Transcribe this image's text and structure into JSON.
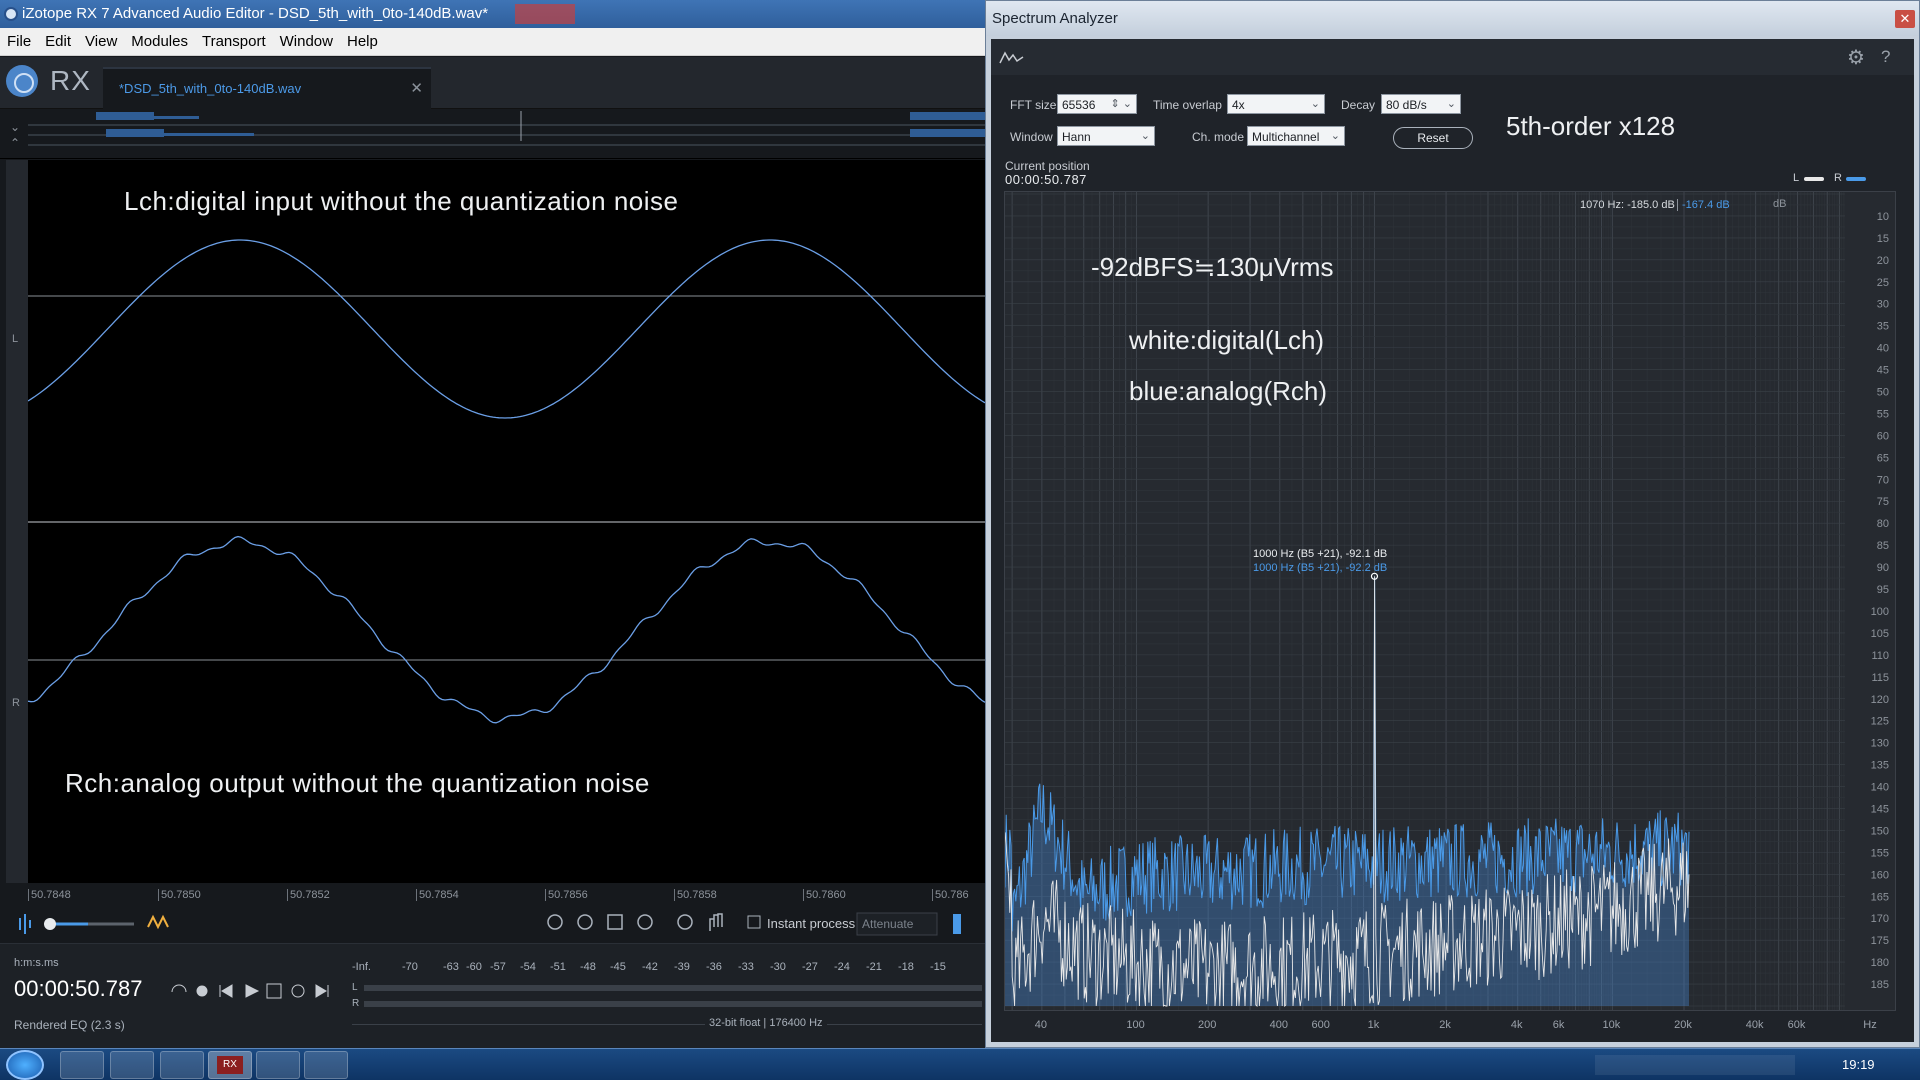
{
  "app": {
    "title": "iZotope RX 7 Advanced Audio Editor - DSD_5th_with_0to-140dB.wav*",
    "menu": [
      "File",
      "Edit",
      "View",
      "Modules",
      "Transport",
      "Window",
      "Help"
    ],
    "logo": "RX",
    "file_tab": "*DSD_5th_with_0to-140dB.wav",
    "channel_labels": {
      "l": "L",
      "r": "R"
    },
    "annotations": {
      "lch": "Lch:digital input without the quantization noise",
      "rch": "Rch:analog output without the quantization noise"
    },
    "time_ruler": [
      "50.7848",
      "50.7850",
      "50.7852",
      "50.7854",
      "50.7856",
      "50.7858",
      "50.7860",
      "50.786"
    ],
    "instant_process": "Instant process",
    "attenuate": "Attenuate",
    "time_format": "h:m:s.ms",
    "time": "00:00:50.787",
    "status": "Rendered EQ (2.3 s)",
    "meter_scale": [
      "-Inf.",
      "-70",
      "-63",
      "-60",
      "-57",
      "-54",
      "-51",
      "-48",
      "-45",
      "-42",
      "-39",
      "-36",
      "-33",
      "-30",
      "-27",
      "-24",
      "-21",
      "-18",
      "-15"
    ],
    "meter_labels": {
      "l": "L",
      "r": "R"
    },
    "format": "32-bit float | 176400 Hz"
  },
  "spectrum": {
    "title": "Spectrum Analyzer",
    "fft_size_label": "FFT size",
    "fft_size": "65536",
    "time_overlap_label": "Time overlap",
    "time_overlap": "4x",
    "decay_label": "Decay",
    "decay": "80 dB/s",
    "window_label": "Window",
    "window": "Hann",
    "ch_mode_label": "Ch. mode",
    "ch_mode": "Multichannel",
    "reset": "Reset",
    "current_position_label": "Current position",
    "current_position": "00:00:50.787",
    "legend": {
      "l": "L",
      "r": "R"
    },
    "cursor_readout": "1070 Hz: -185.0 dB",
    "cursor_readout_r": "-167.4 dB",
    "db_unit": "dB",
    "peak_l": "1000 Hz (B5 +21), -92.1 dB",
    "peak_r": "1000 Hz (B5 +21), -92.2 dB",
    "notes": {
      "order": "5th-order x128",
      "level": "-92dBFS≒130μVrms",
      "white": "white:digital(Lch)",
      "blue": "blue:analog(Rch)"
    },
    "colors": {
      "l": "#e8e8e8",
      "r": "#4a9ae8"
    }
  },
  "chart_data": {
    "type": "line",
    "xlabel": "Hz",
    "ylabel": "dB",
    "x_scale": "log",
    "x_ticks": [
      "40",
      "100",
      "200",
      "400",
      "600",
      "1k",
      "2k",
      "4k",
      "6k",
      "10k",
      "20k",
      "40k",
      "60k",
      "Hz"
    ],
    "y_ticks": [
      10,
      15,
      20,
      25,
      30,
      35,
      40,
      45,
      50,
      55,
      60,
      65,
      70,
      75,
      80,
      85,
      90,
      95,
      100,
      105,
      110,
      115,
      120,
      125,
      130,
      135,
      140,
      145,
      150,
      155,
      160,
      165,
      170,
      175,
      180,
      185
    ],
    "ylim": [
      -190,
      -5
    ],
    "series": [
      {
        "name": "L",
        "points": [
          [
            30,
            -185
          ],
          [
            40,
            -170
          ],
          [
            60,
            -178
          ],
          [
            100,
            -180
          ],
          [
            200,
            -182
          ],
          [
            500,
            -180
          ],
          [
            1000,
            -92.1
          ],
          [
            2000,
            -176
          ],
          [
            5000,
            -172
          ],
          [
            10000,
            -168
          ],
          [
            20000,
            -162
          ]
        ]
      },
      {
        "name": "R",
        "points": [
          [
            30,
            -170
          ],
          [
            40,
            -145
          ],
          [
            60,
            -165
          ],
          [
            100,
            -160
          ],
          [
            200,
            -160
          ],
          [
            500,
            -158
          ],
          [
            1000,
            -92.2
          ],
          [
            2000,
            -157
          ],
          [
            5000,
            -156
          ],
          [
            10000,
            -155
          ],
          [
            20000,
            -154
          ]
        ]
      }
    ]
  }
}
